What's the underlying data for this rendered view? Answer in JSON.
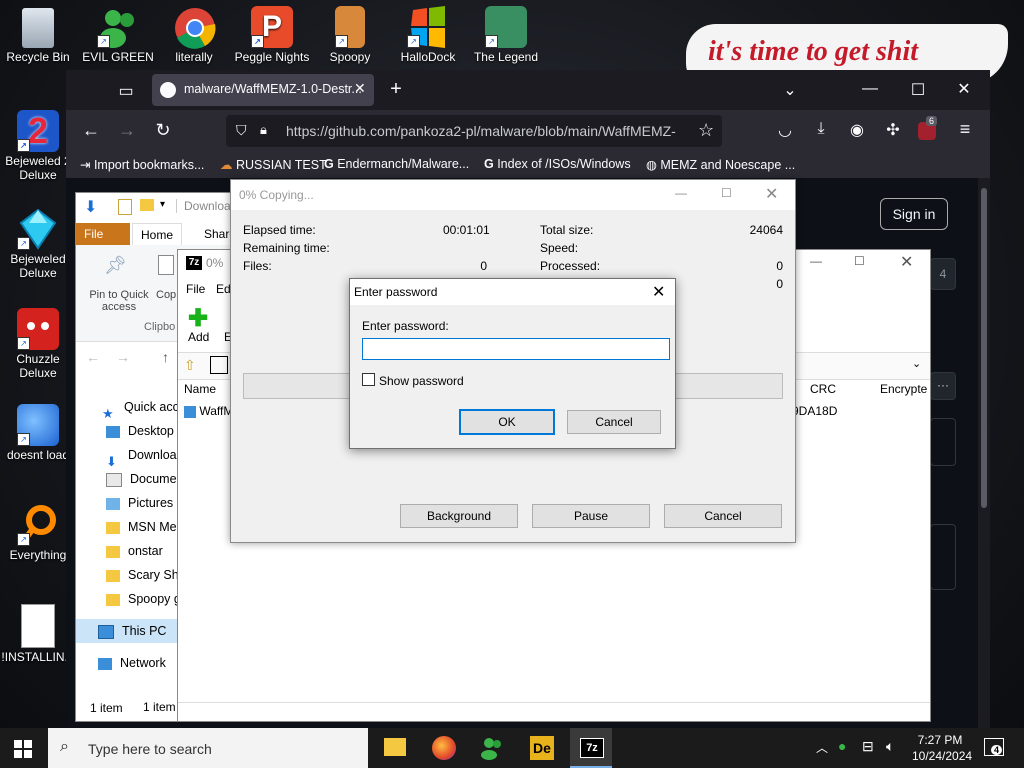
{
  "desktop": {
    "icons_left": [
      {
        "label": "Recycle Bin",
        "icon": "recycle-bin-icon"
      },
      {
        "label": "Bejeweled 2 Deluxe",
        "icon": "bejeweled2-icon"
      },
      {
        "label": "Bejeweled Deluxe",
        "icon": "bejeweled-icon"
      },
      {
        "label": "Chuzzle Deluxe",
        "icon": "chuzzle-icon"
      },
      {
        "label": "doesnt load",
        "icon": "thunderbird-icon"
      },
      {
        "label": "Everything",
        "icon": "everything-icon"
      },
      {
        "label": "!INSTALLIN...",
        "icon": "document-icon"
      }
    ],
    "icons_top": [
      {
        "label": "EVIL GREEN",
        "icon": "msn-buddy-icon"
      },
      {
        "label": "literally",
        "icon": "chrome-icon"
      },
      {
        "label": "Peggle Nights",
        "icon": "peggle-icon"
      },
      {
        "label": "Spoopy",
        "icon": "spoopy-icon"
      },
      {
        "label": "HalloDock",
        "icon": "windows-logo-icon"
      },
      {
        "label": "The Legend",
        "icon": "legend-icon"
      }
    ],
    "banner_text": "it's time to get shit"
  },
  "firefox": {
    "tab_title": "malware/WaffMEMZ-1.0-Destr...",
    "url": "https://github.com/pankoza2-pl/malware/blob/main/WaffMEMZ-",
    "extension_badge": "6",
    "bookmarks": [
      {
        "label": "Import bookmarks...",
        "icon": "import-icon"
      },
      {
        "label": "RUSSIAN TEST",
        "icon": "mushroom-cloud-icon"
      },
      {
        "label": "Endermanch/Malware...",
        "icon": "google-icon"
      },
      {
        "label": "Index of /ISOs/Windows",
        "icon": "google-icon"
      },
      {
        "label": "MEMZ and Noescape ...",
        "icon": "globe-icon"
      }
    ],
    "signin_label": "Sign in",
    "colors": {
      "frame": "#1c1b22",
      "toolbar": "#2b2a33",
      "tab": "#42414d",
      "github_bg": "#0d1117"
    }
  },
  "explorer": {
    "title_partial": "Downloa",
    "tabs": [
      "File",
      "Home",
      "Share"
    ],
    "ribbon": {
      "pin_label": "Pin to Quick access",
      "copy_label": "Cop",
      "group_label": "Clipbo"
    },
    "nav": [
      {
        "label": "Quick acce",
        "icon": "star-icon"
      },
      {
        "label": "Desktop",
        "icon": "desktop-icon"
      },
      {
        "label": "Download",
        "icon": "download-arrow-icon"
      },
      {
        "label": "Documen",
        "icon": "documents-icon"
      },
      {
        "label": "Pictures",
        "icon": "pictures-icon"
      },
      {
        "label": "MSN Mes",
        "icon": "folder-icon"
      },
      {
        "label": "onstar",
        "icon": "folder-icon"
      },
      {
        "label": "Scary Shi",
        "icon": "folder-icon"
      },
      {
        "label": "Spoopy g",
        "icon": "folder-icon"
      },
      {
        "label": "This PC",
        "icon": "this-pc-icon"
      },
      {
        "label": "Network",
        "icon": "network-icon"
      }
    ],
    "status": "1 item"
  },
  "sevenzip": {
    "title": "0%",
    "menu": [
      "File",
      "Ed"
    ],
    "add_label": "Add",
    "add_next": "E",
    "col_name": "Name",
    "col_crc": "CRC",
    "col_encrypted": "Encrypte",
    "row_name": "WaffM",
    "row_crc": "9DA18D",
    "status": "1 item",
    "partial_right": "4"
  },
  "copy_dialog": {
    "title": "0% Copying...",
    "elapsed_label": "Elapsed time:",
    "elapsed_value": "00:01:01",
    "remaining_label": "Remaining time:",
    "files_label": "Files:",
    "files_value": "0",
    "total_label": "Total size:",
    "total_value": "24064",
    "speed_label": "Speed:",
    "processed_label": "Processed:",
    "processed_value": "0",
    "extra_value": "0",
    "background_label": "Background",
    "pause_label": "Pause",
    "cancel_label": "Cancel"
  },
  "password_dialog": {
    "title": "Enter password",
    "prompt": "Enter password:",
    "value": "",
    "show_password": "Show password",
    "ok": "OK",
    "cancel": "Cancel"
  },
  "taskbar": {
    "search_placeholder": "Type here to search",
    "time": "7:27 PM",
    "date": "10/24/2024",
    "notification_count": "4",
    "colors": {
      "bar": "#1b1b1b",
      "search": "#f3f3f3"
    }
  }
}
